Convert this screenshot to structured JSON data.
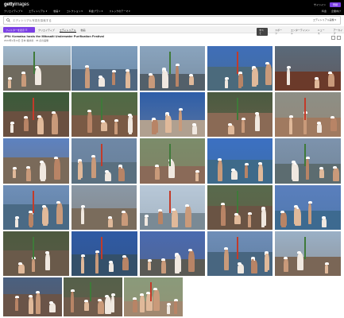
{
  "header": {
    "logo_bold": "getty",
    "logo_thin": "images",
    "nav": [
      "クリエイティブ ▾",
      "エディトリアル ▾",
      "動画 ▾",
      "コレクション ▾",
      "料金プラン ▾",
      "ストックのテーマ ▾"
    ],
    "signin_label": "サインイン",
    "signup_label": "登録",
    "secondary": [
      "料金",
      "企業向け"
    ]
  },
  "search": {
    "placeholder": "エディトリアル写真を探索する",
    "scope_label": "エディトリアル画像 ▾"
  },
  "filters": {
    "filter_label": "フィルターを表示 ☰",
    "tabs": [
      "クリエイティブ",
      "エディトリアル",
      "動画"
    ],
    "active_tab_index": 1,
    "right_tabs": [
      "すべて",
      "スポーツ",
      "エンターテイメント",
      "ニュース",
      "アーカイブ"
    ],
    "selected_right_index": 0
  },
  "event": {
    "title": "JPN: Komatsu hosts the Mitosaiti Underwater Purification Festival",
    "meta": "2024年1月14日 日本 福井県 · 36 点の画像"
  },
  "images": [
    {
      "alt": "festival participants on beach with mikoshi",
      "sky": "#9fb7cc",
      "ground": "#6f6a5e"
    },
    {
      "alt": "man raising arms in water",
      "sky": "#7f9ebd",
      "ground": "#4f6780"
    },
    {
      "alt": "coastline with people",
      "sky": "#8aa4be",
      "ground": "#53606a"
    },
    {
      "alt": "people in sea under blue sky",
      "sky": "#3f6eb8",
      "ground": "#4b6a7c"
    },
    {
      "alt": "decorated mikoshi portable shrine",
      "sky": "#5a6a7a",
      "ground": "#6b3a2a"
    },
    {
      "alt": "men carrying green bamboo shrine",
      "sky": "#3b5a3a",
      "ground": "#6a5040"
    },
    {
      "alt": "crowd carrying shrine with branches",
      "sky": "#4f6a45",
      "ground": "#7a5a45"
    },
    {
      "alt": "man with bamboo pole against sky",
      "sky": "#2e5ea8",
      "ground": "#b0a090"
    },
    {
      "alt": "participants in white headbands",
      "sky": "#4a5a40",
      "ground": "#8a6a55"
    },
    {
      "alt": "half naked men group",
      "sky": "#8d8f86",
      "ground": "#a07a60"
    },
    {
      "alt": "men walking into water wide angle",
      "sky": "#5d82c0",
      "ground": "#7a6a5a"
    },
    {
      "alt": "shrine in sea water",
      "sky": "#6f88a6",
      "ground": "#5a7080"
    },
    {
      "alt": "men on shore carrying pole",
      "sky": "#7b8c6a",
      "ground": "#8a6a58"
    },
    {
      "alt": "group holding shrine in water",
      "sky": "#3c70c2",
      "ground": "#3e6a8a"
    },
    {
      "alt": "white robed participants",
      "sky": "#7d93ad",
      "ground": "#5c6c70"
    },
    {
      "alt": "shrine with green branches in sea",
      "sky": "#6f8fb8",
      "ground": "#4a6a85"
    },
    {
      "alt": "man standing on beach",
      "sky": "#8a98a6",
      "ground": "#7a6c5c"
    },
    {
      "alt": "men holding red frame in water",
      "sky": "#b8c8d8",
      "ground": "#7a8a95"
    },
    {
      "alt": "crowd on shore with shrine",
      "sky": "#586a4c",
      "ground": "#6a5444"
    },
    {
      "alt": "decorated shrine in surf",
      "sky": "#5a7fbd",
      "ground": "#3d6a90"
    },
    {
      "alt": "dense crowd cheering",
      "sky": "#4d5a40",
      "ground": "#6a5a4a"
    },
    {
      "alt": "man with branches by sea",
      "sky": "#2f5aa4",
      "ground": "#34506a"
    },
    {
      "alt": "shrine carried into waves",
      "sky": "#4a6ab0",
      "ground": "#5a5a55"
    },
    {
      "alt": "men in sea with colorful shrine",
      "sky": "#6f8eb8",
      "ground": "#486680"
    },
    {
      "alt": "participant raising fist",
      "sky": "#9ab0c6",
      "ground": "#7a6656"
    },
    {
      "alt": "crowd carrying shrine on beach",
      "sky": "#4a6080",
      "ground": "#6a5448"
    },
    {
      "alt": "crowd close up",
      "sky": "#55604a",
      "ground": "#705c4c"
    },
    {
      "alt": "men in headbands smiling",
      "sky": "#8a9a7a",
      "ground": "#a08870"
    }
  ]
}
